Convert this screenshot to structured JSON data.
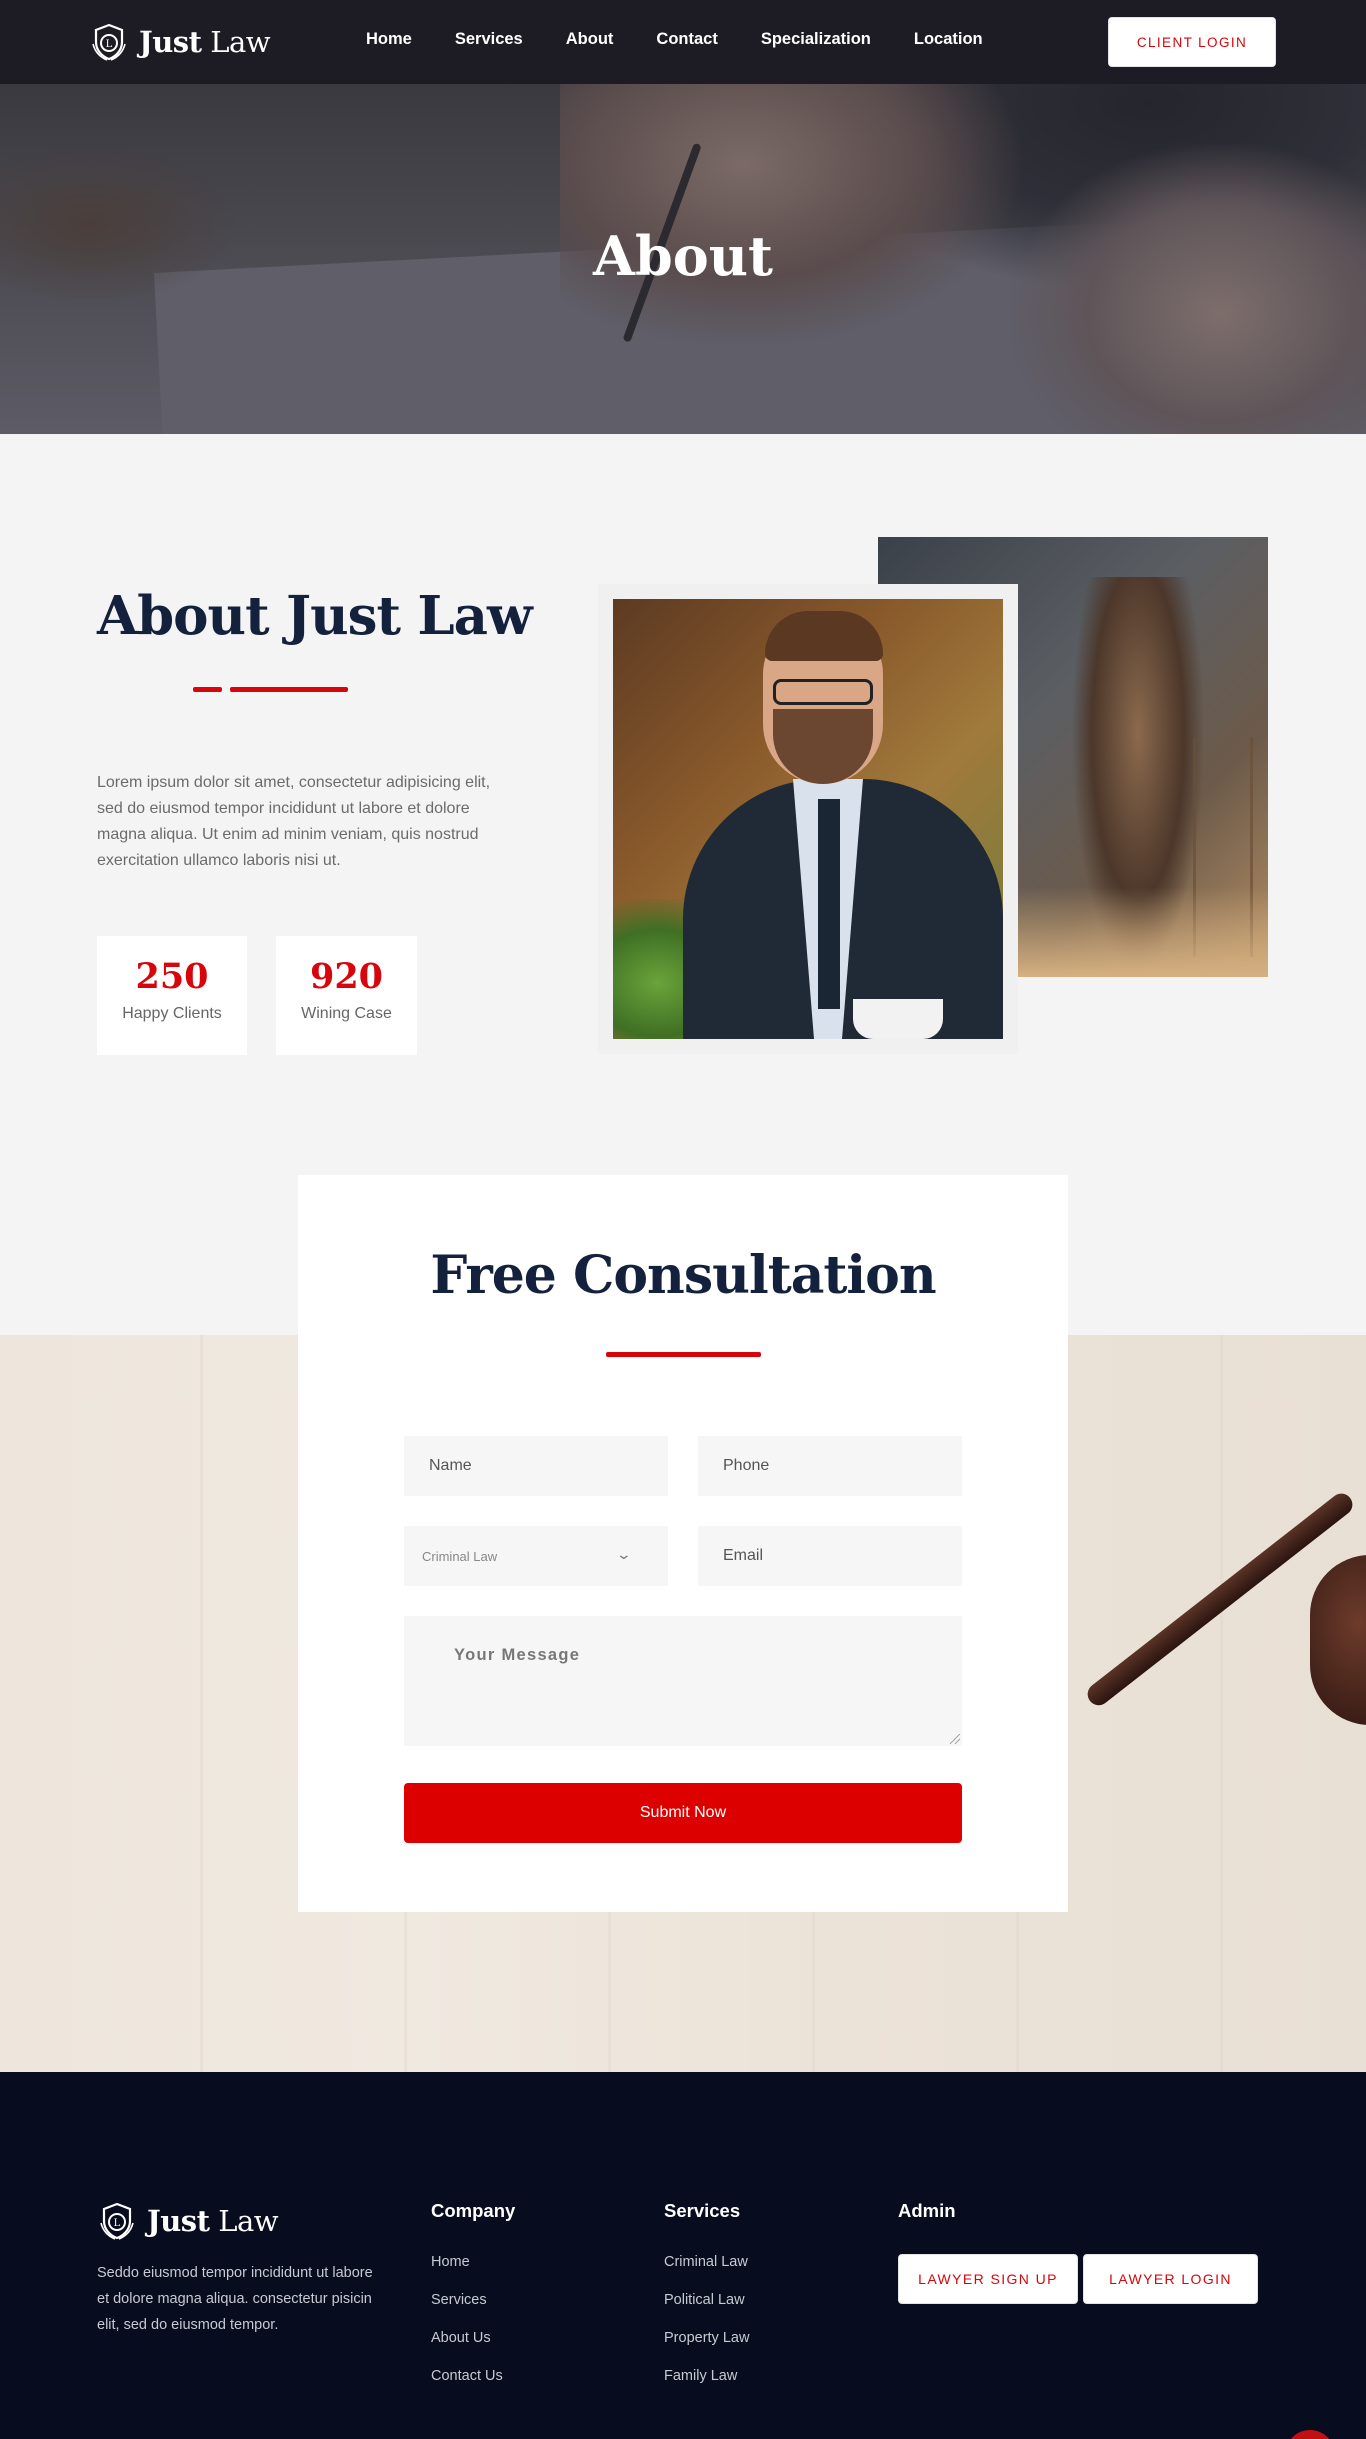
{
  "colors": {
    "accent": "#d6060c",
    "navy": "#14213d",
    "footer_bg": "#070c1e",
    "nav_bg": "#1d1c25"
  },
  "brand": {
    "name_bold": "Just",
    "name_light": "Law",
    "logo_icon": "shield-badge-icon"
  },
  "nav": {
    "links": [
      "Home",
      "Services",
      "About",
      "Contact",
      "Specialization",
      "Location"
    ],
    "client_login": "CLIENT LOGIN"
  },
  "hero": {
    "title": "About"
  },
  "about": {
    "title": "About Just Law",
    "text": "Lorem ipsum dolor sit amet, consectetur adipisicing elit, sed do eiusmod tempor incididunt ut labore et dolore magna aliqua. Ut enim ad minim veniam, quis nostrud exercitation ullamco laboris nisi ut.",
    "stats": [
      {
        "value": "250",
        "label": "Happy Clients"
      },
      {
        "value": "920",
        "label": "Wining Case"
      }
    ]
  },
  "consultation": {
    "title": "Free Consultation",
    "name_placeholder": "Name",
    "phone_placeholder": "Phone",
    "select_value": "Criminal Law",
    "email_placeholder": "Email",
    "message_placeholder": "Your Message",
    "submit_label": "Submit Now"
  },
  "footer": {
    "about_text": "Seddo eiusmod tempor incididunt ut labore et dolore magna aliqua. consectetur pisicin elit, sed do eiusmod tempor.",
    "company": {
      "title": "Company",
      "links": [
        "Home",
        "Services",
        "About Us",
        "Contact Us"
      ]
    },
    "services": {
      "title": "Services",
      "links": [
        "Criminal Law",
        "Political Law",
        "Property Law",
        "Family Law"
      ]
    },
    "admin": {
      "title": "Admin",
      "signup_label": "LAWYER SIGN UP",
      "login_label": "LAWYER LOGIN"
    }
  }
}
